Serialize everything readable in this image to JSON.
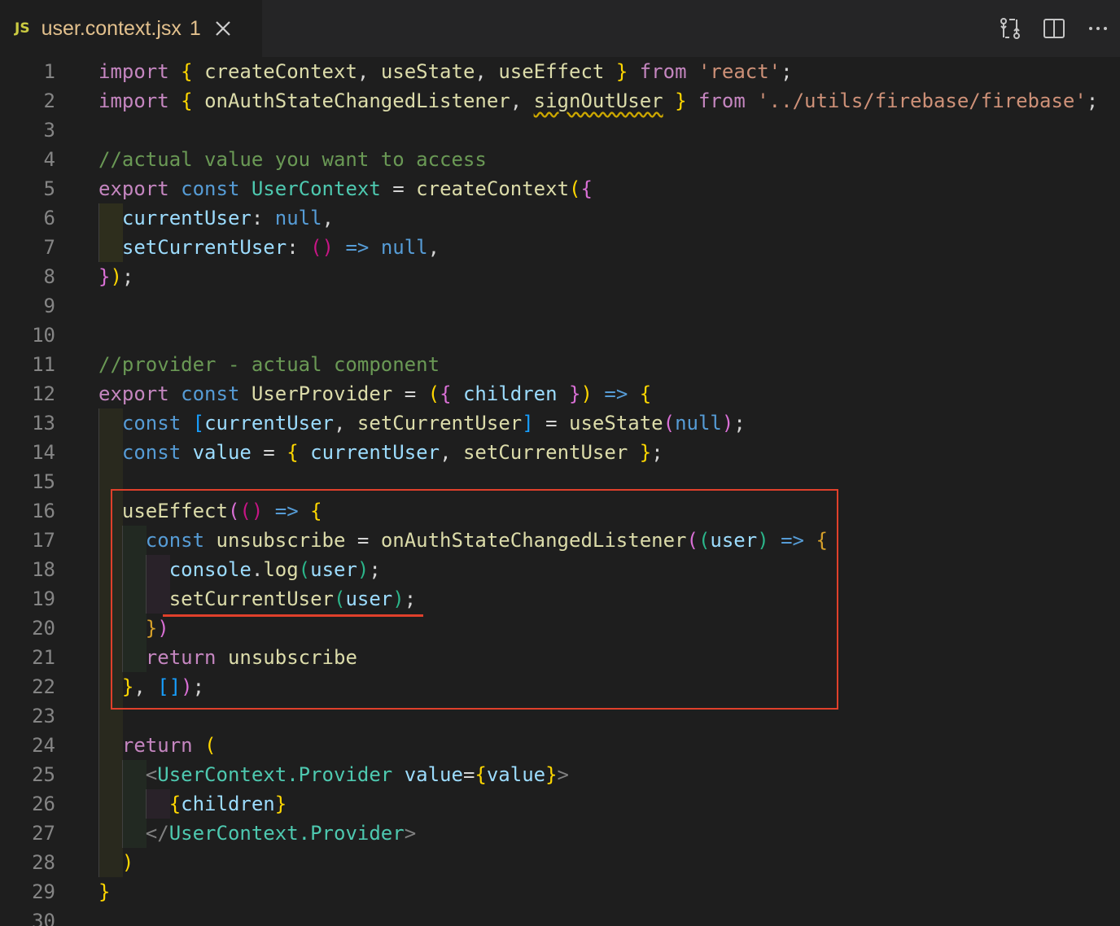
{
  "tab": {
    "language_badge": "JS",
    "title": "user.context.jsx",
    "problems": "1"
  },
  "actions": [
    {
      "icon": "compare-changes-icon"
    },
    {
      "icon": "split-editor-icon"
    },
    {
      "icon": "more-actions-icon"
    }
  ],
  "line_numbers": [
    "1",
    "2",
    "3",
    "4",
    "5",
    "6",
    "7",
    "8",
    "9",
    "10",
    "11",
    "12",
    "13",
    "14",
    "15",
    "16",
    "17",
    "18",
    "19",
    "20",
    "21",
    "22",
    "23",
    "24",
    "25",
    "26",
    "27",
    "28",
    "29",
    "30"
  ],
  "code_lines": [
    [
      [
        "kw",
        "import"
      ],
      [
        "pun",
        " "
      ],
      [
        "b1",
        "{"
      ],
      [
        "pun",
        " "
      ],
      [
        "fn",
        "createContext"
      ],
      [
        "pun",
        ", "
      ],
      [
        "fn",
        "useState"
      ],
      [
        "pun",
        ", "
      ],
      [
        "fn",
        "useEffect"
      ],
      [
        "pun",
        " "
      ],
      [
        "b1",
        "}"
      ],
      [
        "pun",
        " "
      ],
      [
        "kw",
        "from"
      ],
      [
        "pun",
        " "
      ],
      [
        "str",
        "'react'"
      ],
      [
        "pun",
        ";"
      ]
    ],
    [
      [
        "kw",
        "import"
      ],
      [
        "pun",
        " "
      ],
      [
        "b1",
        "{"
      ],
      [
        "pun",
        " "
      ],
      [
        "fn",
        "onAuthStateChangedListener"
      ],
      [
        "pun",
        ", "
      ],
      [
        "fnw",
        "signOutUser"
      ],
      [
        "pun",
        " "
      ],
      [
        "b1",
        "}"
      ],
      [
        "pun",
        " "
      ],
      [
        "kw",
        "from"
      ],
      [
        "pun",
        " "
      ],
      [
        "str",
        "'../utils/firebase/firebase'"
      ],
      [
        "pun",
        ";"
      ]
    ],
    [],
    [
      [
        "com",
        "//actual value you want to access"
      ]
    ],
    [
      [
        "kw",
        "export"
      ],
      [
        "pun",
        " "
      ],
      [
        "st",
        "const"
      ],
      [
        "pun",
        " "
      ],
      [
        "cls2",
        "UserContext"
      ],
      [
        "pun",
        " = "
      ],
      [
        "fn",
        "createContext"
      ],
      [
        "b1",
        "("
      ],
      [
        "b2",
        "{"
      ]
    ],
    [
      [
        "pun",
        "  "
      ],
      [
        "var",
        "currentUser"
      ],
      [
        "pun",
        ": "
      ],
      [
        "st",
        "null"
      ],
      [
        "pun",
        ","
      ]
    ],
    [
      [
        "pun",
        "  "
      ],
      [
        "var",
        "setCurrentUser"
      ],
      [
        "pun",
        ": "
      ],
      [
        "b3x",
        "()"
      ],
      [
        "pun",
        " "
      ],
      [
        "st",
        "=>"
      ],
      [
        "pun",
        " "
      ],
      [
        "st",
        "null"
      ],
      [
        "pun",
        ","
      ]
    ],
    [
      [
        "b2",
        "}"
      ],
      [
        "b1",
        ")"
      ],
      [
        "pun",
        ";"
      ]
    ],
    [],
    [],
    [
      [
        "com",
        "//provider - actual component"
      ]
    ],
    [
      [
        "kw",
        "export"
      ],
      [
        "pun",
        " "
      ],
      [
        "st",
        "const"
      ],
      [
        "pun",
        " "
      ],
      [
        "fn",
        "UserProvider"
      ],
      [
        "pun",
        " = "
      ],
      [
        "b1",
        "("
      ],
      [
        "b2",
        "{"
      ],
      [
        "pun",
        " "
      ],
      [
        "var",
        "children"
      ],
      [
        "pun",
        " "
      ],
      [
        "b2",
        "}"
      ],
      [
        "b1",
        ")"
      ],
      [
        "pun",
        " "
      ],
      [
        "st",
        "=>"
      ],
      [
        "pun",
        " "
      ],
      [
        "b1",
        "{"
      ]
    ],
    [
      [
        "pun",
        "  "
      ],
      [
        "st",
        "const"
      ],
      [
        "pun",
        " "
      ],
      [
        "b2x",
        "["
      ],
      [
        "var",
        "currentUser"
      ],
      [
        "pun",
        ", "
      ],
      [
        "fn",
        "setCurrentUser"
      ],
      [
        "b2x",
        "]"
      ],
      [
        "pun",
        " = "
      ],
      [
        "fn",
        "useState"
      ],
      [
        "b2",
        "("
      ],
      [
        "st",
        "null"
      ],
      [
        "b2",
        ")"
      ],
      [
        "pun",
        ";"
      ]
    ],
    [
      [
        "pun",
        "  "
      ],
      [
        "st",
        "const"
      ],
      [
        "pun",
        " "
      ],
      [
        "var",
        "value"
      ],
      [
        "pun",
        " = "
      ],
      [
        "b1",
        "{"
      ],
      [
        "pun",
        " "
      ],
      [
        "var",
        "currentUser"
      ],
      [
        "pun",
        ", "
      ],
      [
        "fn",
        "setCurrentUser"
      ],
      [
        "pun",
        " "
      ],
      [
        "b1",
        "}"
      ],
      [
        "pun",
        ";"
      ]
    ],
    [],
    [
      [
        "pun",
        "  "
      ],
      [
        "fn",
        "useEffect"
      ],
      [
        "b2",
        "("
      ],
      [
        "b3x",
        "()"
      ],
      [
        "pun",
        " "
      ],
      [
        "st",
        "=>"
      ],
      [
        "pun",
        " "
      ],
      [
        "b1",
        "{"
      ]
    ],
    [
      [
        "pun",
        "    "
      ],
      [
        "st",
        "const"
      ],
      [
        "pun",
        " "
      ],
      [
        "fn",
        "unsubscribe"
      ],
      [
        "pun",
        " = "
      ],
      [
        "fn",
        "onAuthStateChangedListener"
      ],
      [
        "b2",
        "("
      ],
      [
        "b3g",
        "("
      ],
      [
        "var",
        "user"
      ],
      [
        "b3g",
        ")"
      ],
      [
        "pun",
        " "
      ],
      [
        "st",
        "=>"
      ],
      [
        "pun",
        " "
      ],
      [
        "b1y",
        "{"
      ]
    ],
    [
      [
        "pun",
        "      "
      ],
      [
        "var",
        "console"
      ],
      [
        "pun",
        "."
      ],
      [
        "fn",
        "log"
      ],
      [
        "b3g",
        "("
      ],
      [
        "var",
        "user"
      ],
      [
        "b3g",
        ")"
      ],
      [
        "pun",
        ";"
      ]
    ],
    [
      [
        "pun",
        "      "
      ],
      [
        "fn",
        "setCurrentUser"
      ],
      [
        "b3g",
        "("
      ],
      [
        "var",
        "user"
      ],
      [
        "b3g",
        ")"
      ],
      [
        "pun",
        ";"
      ]
    ],
    [
      [
        "pun",
        "    "
      ],
      [
        "b1y",
        "}"
      ],
      [
        "b2",
        ")"
      ]
    ],
    [
      [
        "pun",
        "    "
      ],
      [
        "kw",
        "return"
      ],
      [
        "pun",
        " "
      ],
      [
        "fn",
        "unsubscribe"
      ]
    ],
    [
      [
        "pun",
        "  "
      ],
      [
        "b1",
        "}"
      ],
      [
        "pun",
        ", "
      ],
      [
        "b3",
        "[]"
      ],
      [
        "b2",
        ")"
      ],
      [
        "pun",
        ";"
      ]
    ],
    [],
    [
      [
        "pun",
        "  "
      ],
      [
        "kw",
        "return"
      ],
      [
        "pun",
        " "
      ],
      [
        "b1",
        "("
      ]
    ],
    [
      [
        "pun",
        "    "
      ],
      [
        "tag",
        "<"
      ],
      [
        "cls",
        "UserContext.Provider"
      ],
      [
        "pun",
        " "
      ],
      [
        "var",
        "value"
      ],
      [
        "pun",
        "="
      ],
      [
        "b2y",
        "{"
      ],
      [
        "var",
        "value"
      ],
      [
        "b2y",
        "}"
      ],
      [
        "tag",
        ">"
      ]
    ],
    [
      [
        "pun",
        "      "
      ],
      [
        "b2y",
        "{"
      ],
      [
        "var",
        "children"
      ],
      [
        "b2y",
        "}"
      ]
    ],
    [
      [
        "pun",
        "    "
      ],
      [
        "tag",
        "</"
      ],
      [
        "cls",
        "UserContext.Provider"
      ],
      [
        "tag",
        ">"
      ]
    ],
    [
      [
        "pun",
        "  "
      ],
      [
        "b1",
        ")"
      ]
    ],
    [
      [
        "b1",
        "}"
      ]
    ],
    []
  ]
}
